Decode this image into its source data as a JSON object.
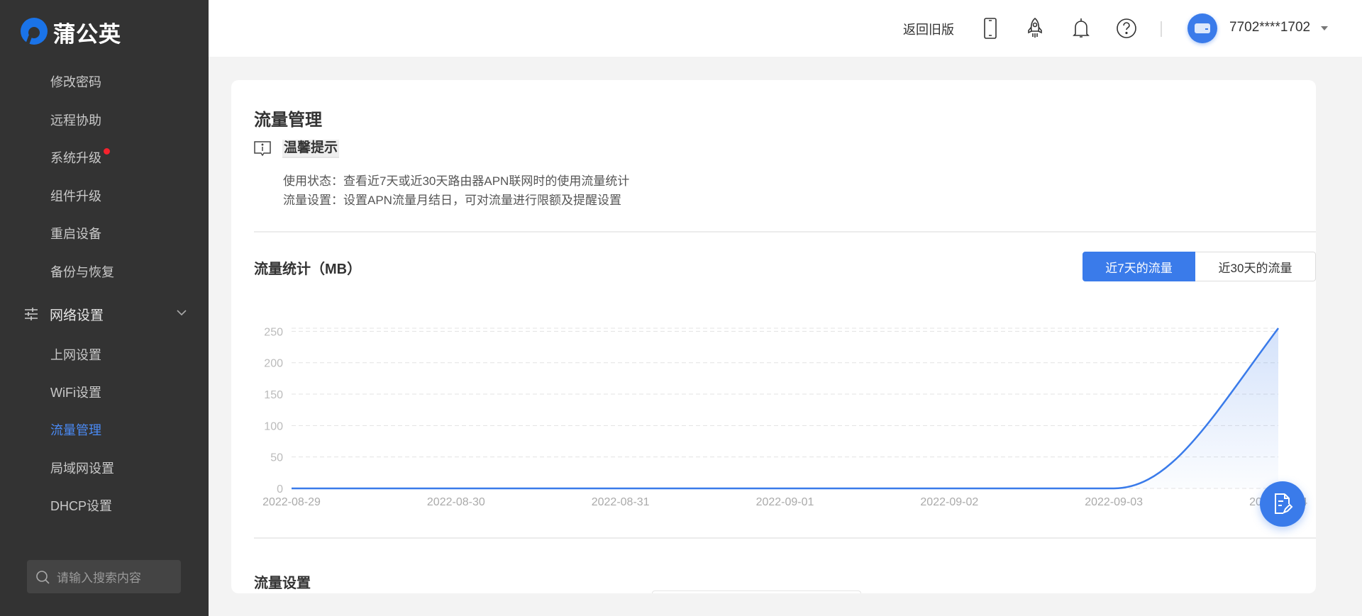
{
  "brand": {
    "name": "蒲公英",
    "color": "#1a73e8"
  },
  "sidebar": {
    "items": [
      {
        "label": "修改密码"
      },
      {
        "label": "远程协助"
      },
      {
        "label": "系统升级",
        "badge": true
      },
      {
        "label": "组件升级"
      },
      {
        "label": "重启设备"
      },
      {
        "label": "备份与恢复"
      }
    ],
    "group": {
      "label": "网络设置",
      "icon": "sliders-icon"
    },
    "subitems": [
      {
        "label": "上网设置"
      },
      {
        "label": "WiFi设置"
      },
      {
        "label": "流量管理",
        "active": true
      },
      {
        "label": "局域网设置"
      },
      {
        "label": "DHCP设置"
      }
    ],
    "search_placeholder": "请输入搜索内容"
  },
  "header": {
    "back_old": "返回旧版",
    "username": "7702****1702",
    "icons": [
      "phone-icon",
      "rocket-icon",
      "bell-icon",
      "help-icon"
    ]
  },
  "main": {
    "title": "流量管理",
    "tip_title": "温馨提示",
    "tip_lines": [
      "使用状态：查看近7天或近30天路由器APN联网时的使用流量统计",
      "流量设置：设置APN流量月结日，可对流量进行限额及提醒设置"
    ],
    "stats_title": "流量统计（MB）",
    "tabs": [
      {
        "label": "近7天的流量",
        "active": true
      },
      {
        "label": "近30天的流量",
        "active": false
      }
    ],
    "settings_title": "流量设置"
  },
  "colors": {
    "accent": "#3a7bea",
    "sidebar_bg": "#333333"
  },
  "chart_data": {
    "type": "area",
    "x": [
      "2022-08-29",
      "2022-08-30",
      "2022-08-31",
      "2022-09-01",
      "2022-09-02",
      "2022-09-03",
      "2022-09-04"
    ],
    "values": [
      0,
      0,
      0,
      0,
      0,
      0,
      255
    ],
    "yticks": [
      0,
      50,
      100,
      150,
      200,
      250
    ],
    "ylim": [
      0,
      255
    ],
    "ylabel": "MB",
    "grid": true
  }
}
